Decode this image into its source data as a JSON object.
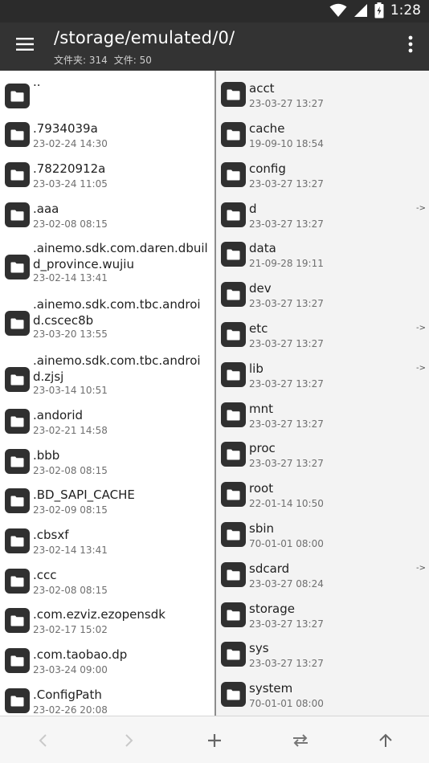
{
  "status_bar": {
    "time": "1:28",
    "icons": [
      "wifi-icon",
      "signal-icon",
      "battery-icon"
    ]
  },
  "app_bar": {
    "title": "/storage/emulated/0/",
    "folders_label": "文件夹: 314",
    "files_label": "文件: 50"
  },
  "left_pane": [
    {
      "name": "..",
      "date": ""
    },
    {
      "name": ".7934039a",
      "date": "23-02-24 14:30"
    },
    {
      "name": ".78220912a",
      "date": "23-03-24 11:05"
    },
    {
      "name": ".aaa",
      "date": "23-02-08 08:15"
    },
    {
      "name": ".ainemo.sdk.com.daren.dbuild_province.wujiu",
      "date": "23-02-14 13:41"
    },
    {
      "name": ".ainemo.sdk.com.tbc.android.cscec8b",
      "date": "23-03-20 13:55"
    },
    {
      "name": ".ainemo.sdk.com.tbc.android.zjsj",
      "date": "23-03-14 10:51"
    },
    {
      "name": ".andorid",
      "date": "23-02-21 14:58"
    },
    {
      "name": ".bbb",
      "date": "23-02-08 08:15"
    },
    {
      "name": ".BD_SAPI_CACHE",
      "date": "23-02-09 08:15"
    },
    {
      "name": ".cbsxf",
      "date": "23-02-14 13:41"
    },
    {
      "name": ".ccc",
      "date": "23-02-08 08:15"
    },
    {
      "name": ".com.ezviz.ezopensdk",
      "date": "23-02-17 15:02"
    },
    {
      "name": ".com.taobao.dp",
      "date": "23-03-24 09:00"
    },
    {
      "name": ".ConfigPath",
      "date": "23-02-26 20:08"
    }
  ],
  "right_pane": [
    {
      "name": "acct",
      "date": "23-03-27 13:27",
      "link": ""
    },
    {
      "name": "cache",
      "date": "19-09-10 18:54",
      "link": ""
    },
    {
      "name": "config",
      "date": "23-03-27 13:27",
      "link": ""
    },
    {
      "name": "d",
      "date": "23-03-27 13:27",
      "link": "->"
    },
    {
      "name": "data",
      "date": "21-09-28 19:11",
      "link": ""
    },
    {
      "name": "dev",
      "date": "23-03-27 13:27",
      "link": ""
    },
    {
      "name": "etc",
      "date": "23-03-27 13:27",
      "link": "->"
    },
    {
      "name": "lib",
      "date": "23-03-27 13:27",
      "link": "->"
    },
    {
      "name": "mnt",
      "date": "23-03-27 13:27",
      "link": ""
    },
    {
      "name": "proc",
      "date": "23-03-27 13:27",
      "link": ""
    },
    {
      "name": "root",
      "date": "22-01-14 10:50",
      "link": ""
    },
    {
      "name": "sbin",
      "date": "70-01-01 08:00",
      "link": ""
    },
    {
      "name": "sdcard",
      "date": "23-03-27 08:24",
      "link": "->"
    },
    {
      "name": "storage",
      "date": "23-03-27 13:27",
      "link": ""
    },
    {
      "name": "sys",
      "date": "23-03-27 13:27",
      "link": ""
    },
    {
      "name": "system",
      "date": "70-01-01 08:00",
      "link": ""
    }
  ],
  "bottom_bar": [
    "back-icon",
    "forward-icon",
    "add-icon",
    "swap-icon",
    "up-icon"
  ],
  "colors": {
    "app_bar": "#333333",
    "status_bar": "#2b2b2b",
    "folder_icon": "#303030",
    "divider": "#8d8d8d"
  }
}
